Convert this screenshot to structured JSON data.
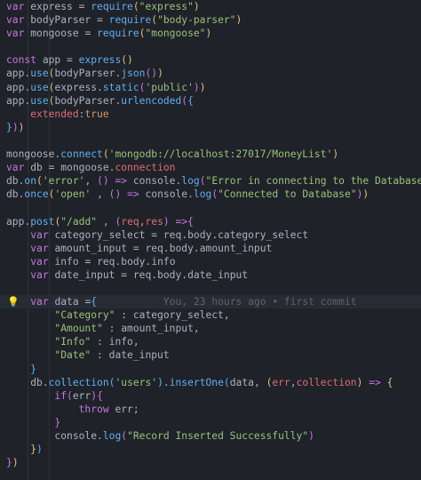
{
  "code": {
    "line_1": {
      "kw": "var",
      "name": "express",
      "op": " = ",
      "fn": "require",
      "arg": "\"express\""
    },
    "line_2": {
      "kw": "var",
      "name": "bodyParser",
      "op": " = ",
      "fn": "require",
      "arg": "\"body-parser\""
    },
    "line_3": {
      "kw": "var",
      "name": "mongoose",
      "op": " = ",
      "fn": "require",
      "arg": "\"mongoose\""
    },
    "line_5": {
      "kw": "const",
      "name": "app",
      "op": " = ",
      "fn": "express"
    },
    "line_6": {
      "obj": "app",
      "fn": "use",
      "inner_obj": "bodyParser",
      "inner_fn": "json"
    },
    "line_7": {
      "obj": "app",
      "fn": "use",
      "inner_obj": "express",
      "inner_fn": "static",
      "arg": "'public'"
    },
    "line_8": {
      "obj": "app",
      "fn": "use",
      "inner_obj": "bodyParser",
      "inner_fn": "urlencoded"
    },
    "line_9": {
      "key": "extended",
      "value": "true"
    },
    "line_12": {
      "obj": "mongoose",
      "fn": "connect",
      "arg": "'mongodb://localhost:27017/MoneyList'"
    },
    "line_13": {
      "kw": "var",
      "name": "db",
      "op": " = ",
      "obj": "mongoose",
      "prop": "connection"
    },
    "line_14": {
      "obj": "db",
      "fn": "on",
      "event": "'error'",
      "arrow": " () => ",
      "log_obj": "console",
      "log_fn": "log",
      "msg": "\"Error in connecting to the Database\""
    },
    "line_15": {
      "obj": "db",
      "fn": "once",
      "event": "'open'",
      "arrow": " () => ",
      "log_obj": "console",
      "log_fn": "log",
      "msg": "\"Connected to Database\""
    },
    "line_17": {
      "obj": "app",
      "fn": "post",
      "route": "\"/add\"",
      "p1": "req",
      "p2": "res"
    },
    "line_18": {
      "kw": "var",
      "name": "category_select",
      "src": "req",
      "a": "body",
      "b": "category_select"
    },
    "line_19": {
      "kw": "var",
      "name": "amount_input",
      "src": "req",
      "a": "body",
      "b": "amount_input"
    },
    "line_20": {
      "kw": "var",
      "name": "info",
      "src": "req",
      "a": "body",
      "b": "info"
    },
    "line_21": {
      "kw": "var",
      "name": "date_input",
      "src": "req",
      "a": "body",
      "b": "date_input"
    },
    "line_23": {
      "kw": "var",
      "name": "data",
      "blame": "You, 23 hours ago • first commit"
    },
    "line_24": {
      "key": "\"Category\"",
      "value": "category_select"
    },
    "line_25": {
      "key": "\"Amount\"",
      "value": "amount_input"
    },
    "line_26": {
      "key": "\"Info\"",
      "value": "info"
    },
    "line_27": {
      "key": "\"Date\"",
      "value": "date_input"
    },
    "line_29": {
      "obj": "db",
      "fn": "collection",
      "arg": "'users'",
      "fn2": "insertOne",
      "a1": "data",
      "p1": "err",
      "p2": "collection"
    },
    "line_30": {
      "kw": "if",
      "cond": "err"
    },
    "line_31": {
      "kw": "throw",
      "value": "err"
    },
    "line_33": {
      "obj": "console",
      "fn": "log",
      "msg": "\"Record Inserted Successfully\""
    }
  },
  "gutter": {
    "icon": "lightbulb-icon",
    "glyph": "💡"
  }
}
